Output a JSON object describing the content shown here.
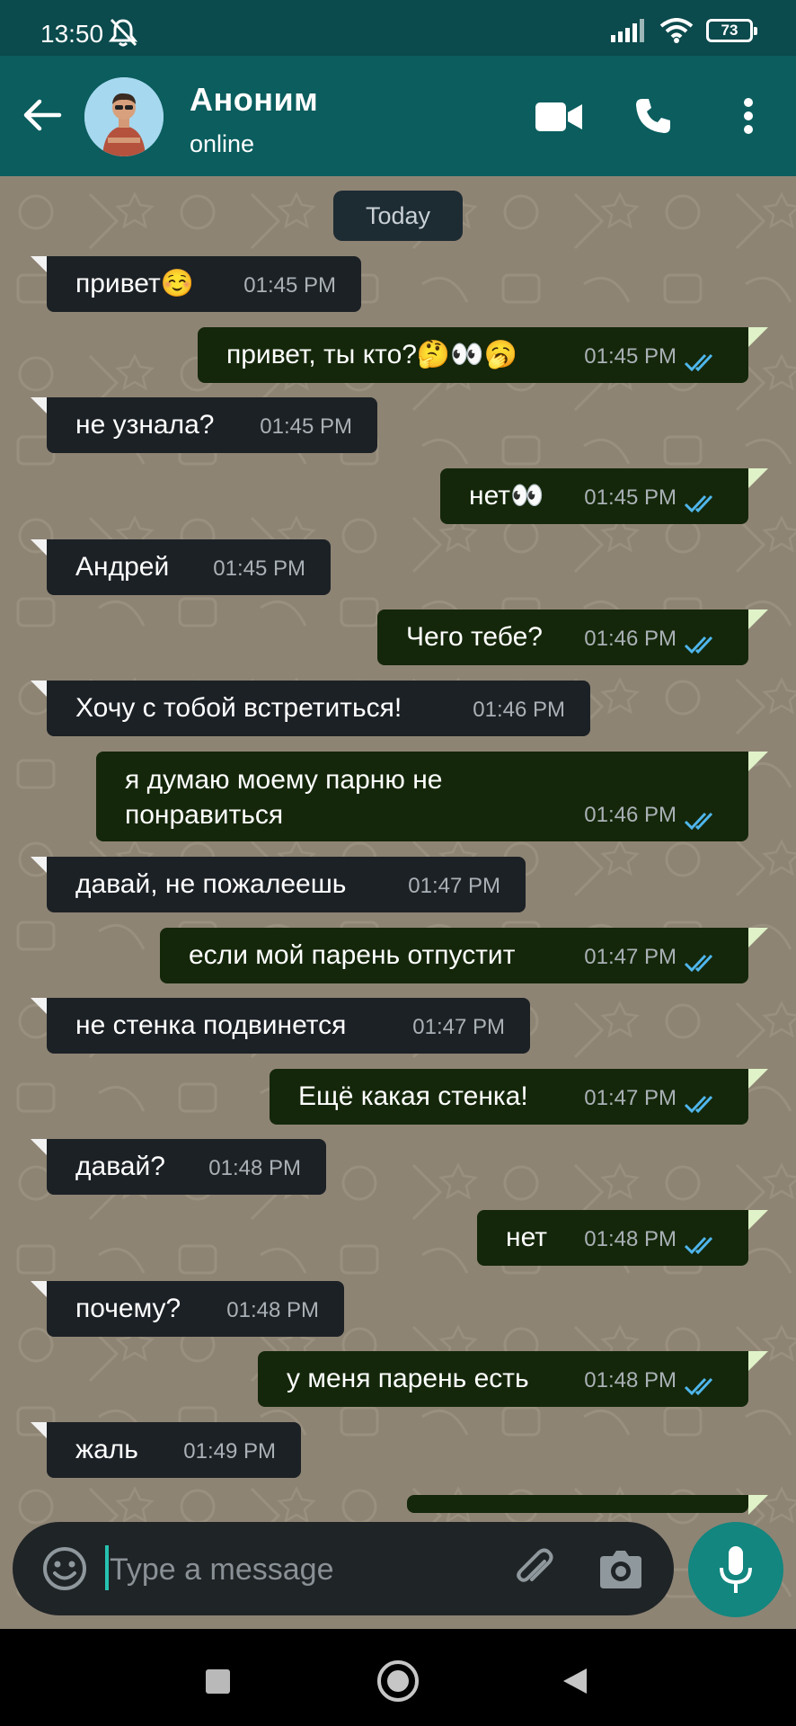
{
  "status_bar": {
    "time": "13:50",
    "battery": "73"
  },
  "header": {
    "contact_name": "Аноним",
    "contact_status": "online"
  },
  "chat": {
    "date_chip": "Today",
    "messages": [
      {
        "dir": "in",
        "text": "привет☺️",
        "time": "01:45 PM"
      },
      {
        "dir": "out",
        "text": "привет, ты кто?🤔👀🥱",
        "time": "01:45 PM"
      },
      {
        "dir": "in",
        "text": "не узнала?",
        "time": "01:45 PM"
      },
      {
        "dir": "out",
        "text": "нет👀",
        "time": "01:45 PM"
      },
      {
        "dir": "in",
        "text": "Андрей",
        "time": "01:45 PM"
      },
      {
        "dir": "out",
        "text": "Чего тебе?",
        "time": "01:46 PM"
      },
      {
        "dir": "in",
        "text": "Хочу с тобой встретиться!",
        "time": "01:46 PM"
      },
      {
        "dir": "out",
        "text": "я думаю моему парню не понравиться",
        "time": "01:46 PM"
      },
      {
        "dir": "in",
        "text": "давай, не пожалеешь",
        "time": "01:47 PM"
      },
      {
        "dir": "out",
        "text": "если мой парень отпустит",
        "time": "01:47 PM"
      },
      {
        "dir": "in",
        "text": "не стенка подвинется",
        "time": "01:47 PM"
      },
      {
        "dir": "out",
        "text": "Ещё какая стенка!",
        "time": "01:47 PM"
      },
      {
        "dir": "in",
        "text": "давай?",
        "time": "01:48 PM"
      },
      {
        "dir": "out",
        "text": "нет",
        "time": "01:48 PM"
      },
      {
        "dir": "in",
        "text": "почему?",
        "time": "01:48 PM"
      },
      {
        "dir": "out",
        "text": "у меня парень есть",
        "time": "01:48 PM"
      },
      {
        "dir": "in",
        "text": "жаль",
        "time": "01:49 PM"
      }
    ]
  },
  "composer": {
    "placeholder": "Type a message"
  },
  "colors": {
    "header": "#0b5d5e",
    "status_bar": "#0b4a4d",
    "incoming_bubble": "#1c2126",
    "outgoing_bubble": "#14270a",
    "read_ticks": "#4fb6ec",
    "mic_button": "#12867f"
  },
  "icons": {
    "back": "arrow-left-icon",
    "video": "video-camera-icon",
    "call": "phone-icon",
    "menu": "more-vertical-icon",
    "emoji": "emoji-icon",
    "attach": "paperclip-icon",
    "camera": "camera-icon",
    "mic": "microphone-icon"
  }
}
